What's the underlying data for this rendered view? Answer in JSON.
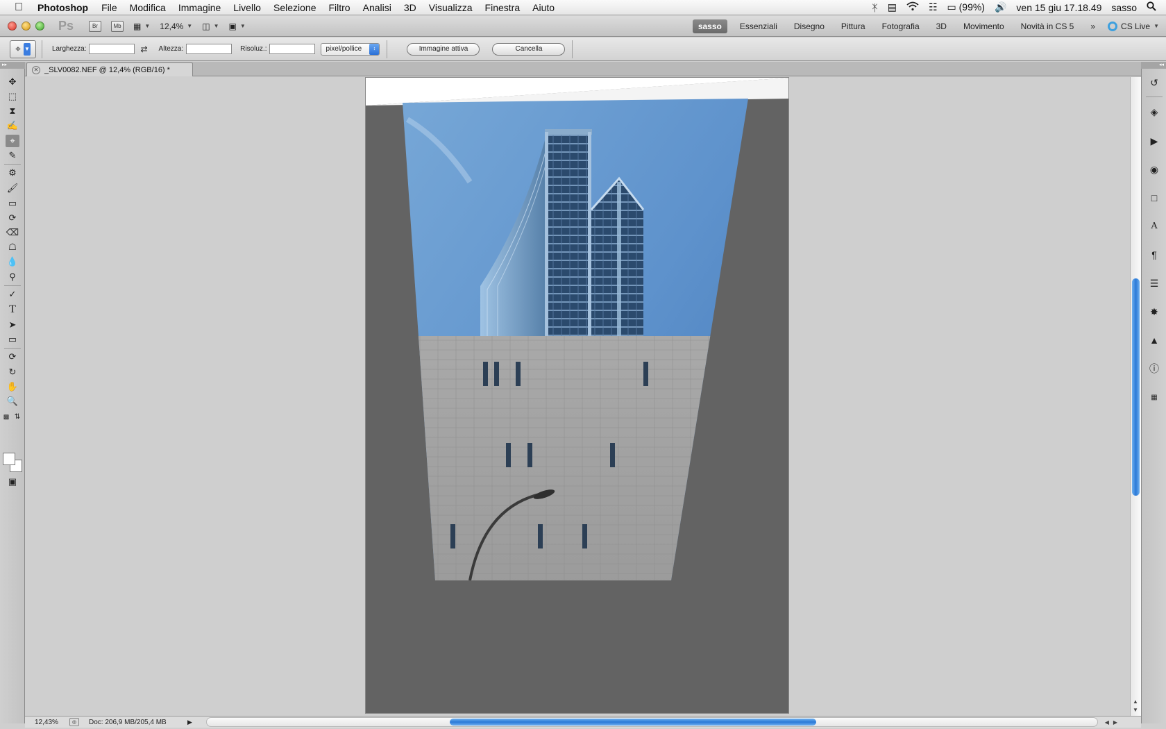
{
  "menubar": {
    "app": "Photoshop",
    "items": [
      "File",
      "Modifica",
      "Immagine",
      "Livello",
      "Selezione",
      "Filtro",
      "Analisi",
      "3D",
      "Visualizza",
      "Finestra",
      "Aiuto"
    ],
    "battery": "(99%)",
    "clock": "ven 15 giu  17.18.49",
    "user": "sasso"
  },
  "appbar": {
    "logo": "Ps",
    "bridge": "Br",
    "minibridge": "Mb",
    "zoom": "12,4%",
    "workspaces": [
      "sasso",
      "Essenziali",
      "Disegno",
      "Pittura",
      "Fotografia",
      "3D",
      "Movimento",
      "Novità in CS 5"
    ],
    "active_workspace": "sasso",
    "more": "»",
    "cslive": "CS Live"
  },
  "options": {
    "width_label": "Larghezza:",
    "width_value": "",
    "height_label": "Altezza:",
    "height_value": "",
    "resolution_label": "Risoluz.:",
    "resolution_value": "",
    "unit": "pixel/pollice",
    "front_image": "Immagine attiva",
    "clear": "Cancella"
  },
  "document": {
    "tab_title": "_SLV0082.NEF @ 12,4% (RGB/16) *"
  },
  "status": {
    "zoom": "12,43%",
    "doc_info": "Doc: 206,9 MB/205,4 MB"
  },
  "colors": {
    "accent_blue": "#2a79d7",
    "canvas_bg": "#cfcfcf",
    "pasteboard": "#636363",
    "sky": "#5a8dc6"
  }
}
